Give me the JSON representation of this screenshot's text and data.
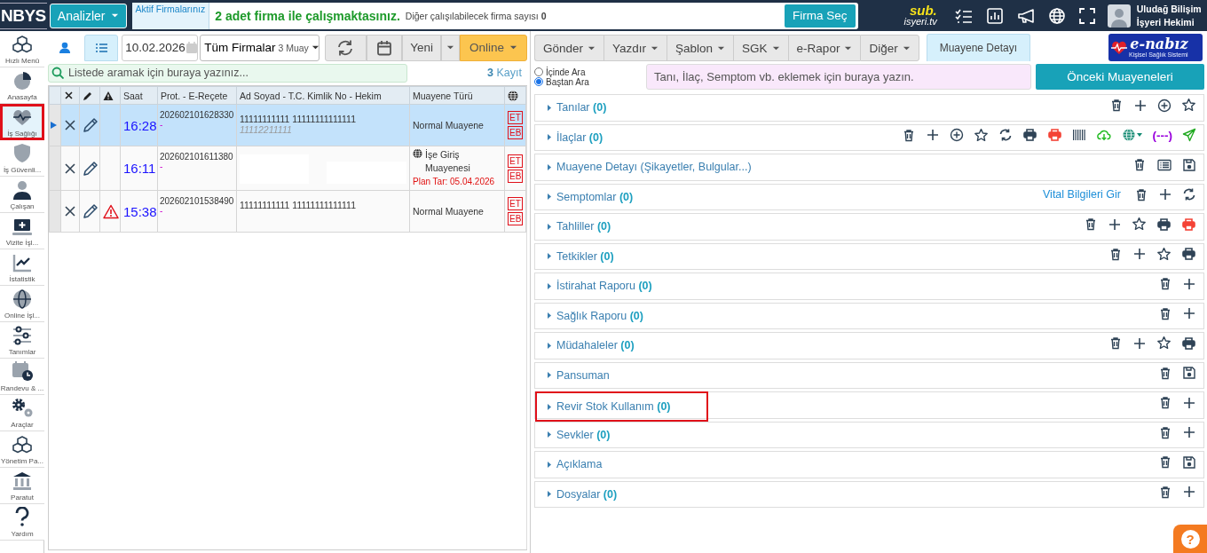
{
  "header": {
    "logo": "NBYS",
    "menu_button": "Analizler",
    "active_label": "Aktif Firmalarınız",
    "firms_message": "2 adet firma ile çalışmaktasınız.",
    "firms_note": "Diğer çalışılabilecek firma sayısı **0**",
    "select_button": "Firma Seç",
    "brand_top": "sub.",
    "brand_bottom": "isyeri.tv",
    "user_name": "Uludağ Bilişim",
    "user_role": "İşyeri Hekimi"
  },
  "sidebar": {
    "items": [
      {
        "label": "Hızlı Menü",
        "kind": "cubes",
        "selected": false,
        "highlighted": false
      },
      {
        "label": "Anasayfa",
        "kind": "pie",
        "selected": false,
        "highlighted": false
      },
      {
        "label": "İş Sağlığı",
        "kind": "heartbeat",
        "selected": true,
        "highlighted": true
      },
      {
        "label": "İş Güvenli...",
        "kind": "shield",
        "selected": false,
        "highlighted": false
      },
      {
        "label": "Çalışan",
        "kind": "user",
        "selected": false,
        "highlighted": false
      },
      {
        "label": "Vizite İşl...",
        "kind": "monitor",
        "selected": false,
        "highlighted": false
      },
      {
        "label": "İstatistik",
        "kind": "chart",
        "selected": false,
        "highlighted": false
      },
      {
        "label": "Online İşl...",
        "kind": "globe",
        "selected": false,
        "highlighted": false
      },
      {
        "label": "Tanımlar",
        "kind": "sliders",
        "selected": false,
        "highlighted": false
      },
      {
        "label": "Randevu & ...",
        "kind": "calendar",
        "selected": false,
        "highlighted": false
      },
      {
        "label": "Araçlar",
        "kind": "gears",
        "selected": false,
        "highlighted": false
      },
      {
        "label": "Yönetim Pa...",
        "kind": "cubes",
        "selected": false,
        "highlighted": false
      },
      {
        "label": "Paratut",
        "kind": "bank",
        "selected": false,
        "highlighted": false
      },
      {
        "label": "Yardım",
        "kind": "question",
        "selected": false,
        "highlighted": false
      }
    ]
  },
  "list_panel": {
    "view_tabs": [
      {
        "kind": "person",
        "selected": false
      },
      {
        "kind": "list",
        "selected": true
      }
    ],
    "date": "10.02.2026",
    "firm_filter": "Tüm Firmalar",
    "firm_filter_note": "3 Muay",
    "new_button": "Yeni",
    "online_button": "Online",
    "search": {
      "placeholder": "Listede aramak için buraya yazınız..."
    },
    "count": "3",
    "count_label": "Kayıt",
    "table": {
      "columns": [
        "Saat",
        "Prot. - E-Reçete",
        "Ad Soyad - T.C. Kimlik No - Hekim",
        "Muayene Türü"
      ],
      "rows": [
        {
          "selected": true,
          "warning": false,
          "time": "16:28",
          "protocol": "202602101628330",
          "protocol_note": "-",
          "name": "11111111111 11111111111111",
          "name_note": "11112211111",
          "redacted": false,
          "online": false,
          "type": "Normal Muayene",
          "plan": "",
          "badges": [
            "ET",
            "EB"
          ]
        },
        {
          "selected": false,
          "warning": false,
          "time": "16:11",
          "protocol": "202602101611380",
          "protocol_note": "-",
          "name": "",
          "name_note": "",
          "redacted": true,
          "online": true,
          "type": "İşe Giriş Muayenesi",
          "plan": "Plan Tar: 05.04.2026",
          "badges": [
            "ET",
            "EB"
          ]
        },
        {
          "selected": false,
          "warning": true,
          "time": "15:38",
          "protocol": "202602101538490",
          "protocol_note": "-",
          "name": "11111111111 11111111111111",
          "name_note": "",
          "redacted": false,
          "online": false,
          "type": "Normal Muayene",
          "plan": "",
          "badges": [
            "ET",
            "EB"
          ]
        }
      ]
    }
  },
  "detail_panel": {
    "toolbar": [
      "Gönder",
      "Yazdır",
      "Şablon",
      "SGK",
      "e-Rapor",
      "Diğer"
    ],
    "tabs": [
      {
        "label": "Muayene Detayı",
        "selected": true
      }
    ],
    "logo_title": "e-nabız",
    "logo_subtitle": "Kişisel Sağlık Sistemi",
    "search_modes": [
      {
        "label": "İçinde Ara",
        "selected": false
      },
      {
        "label": "Baştan Ara",
        "selected": true
      }
    ],
    "add_field": {
      "placeholder": "Tanı, İlaç, Semptom vb. eklemek için buraya yazın."
    },
    "previous_button": "Önceki Muayeneleri",
    "sections": [
      {
        "title": "Tanılar",
        "count": "(0)",
        "highlighted": false,
        "actions": [
          {
            "kind": "trash"
          },
          {
            "kind": "plus"
          },
          {
            "kind": "plus-circle"
          },
          {
            "kind": "star"
          }
        ]
      },
      {
        "title": "İlaçlar",
        "count": "(0)",
        "highlighted": false,
        "actions": [
          {
            "kind": "trash"
          },
          {
            "kind": "plus"
          },
          {
            "kind": "plus-circle"
          },
          {
            "kind": "star"
          },
          {
            "kind": "sync"
          },
          {
            "kind": "print"
          },
          {
            "kind": "print",
            "color": "#f44336"
          },
          {
            "kind": "barcode"
          },
          {
            "kind": "cloud",
            "color": "#22bb22"
          },
          {
            "kind": "globe",
            "color": "#138a72"
          },
          {
            "kind": "text",
            "text": "(---)",
            "color": "#9900dd"
          },
          {
            "kind": "send",
            "color": "#22aa22"
          }
        ]
      },
      {
        "title": "Muayene Detayı (Şikayetler, Bulgular...)",
        "highlighted": false,
        "actions": [
          {
            "kind": "trash"
          },
          {
            "kind": "list"
          },
          {
            "kind": "save"
          }
        ]
      },
      {
        "title": "Semptomlar",
        "count": "(0)",
        "link": "Vital Bilgileri Gir",
        "highlighted": false,
        "actions": [
          {
            "kind": "trash"
          },
          {
            "kind": "plus"
          },
          {
            "kind": "sync"
          }
        ]
      },
      {
        "title": "Tahliller",
        "count": "(0)",
        "highlighted": false,
        "actions": [
          {
            "kind": "trash"
          },
          {
            "kind": "plus"
          },
          {
            "kind": "star"
          },
          {
            "kind": "print"
          },
          {
            "kind": "print",
            "color": "#f44336"
          }
        ]
      },
      {
        "title": "Tetkikler",
        "count": "(0)",
        "highlighted": false,
        "actions": [
          {
            "kind": "trash"
          },
          {
            "kind": "plus"
          },
          {
            "kind": "star"
          },
          {
            "kind": "print"
          }
        ]
      },
      {
        "title": "İstirahat Raporu",
        "count": "(0)",
        "highlighted": false,
        "actions": [
          {
            "kind": "trash"
          },
          {
            "kind": "plus"
          }
        ]
      },
      {
        "title": "Sağlık Raporu",
        "count": "(0)",
        "highlighted": false,
        "actions": [
          {
            "kind": "trash"
          },
          {
            "kind": "plus"
          }
        ]
      },
      {
        "title": "Müdahaleler",
        "count": "(0)",
        "highlighted": false,
        "actions": [
          {
            "kind": "trash"
          },
          {
            "kind": "plus"
          },
          {
            "kind": "star"
          },
          {
            "kind": "print"
          }
        ]
      },
      {
        "title": "Pansuman",
        "highlighted": false,
        "actions": [
          {
            "kind": "trash"
          },
          {
            "kind": "save"
          }
        ]
      },
      {
        "title": "Revir Stok Kullanım",
        "count": "(0)",
        "highlighted": true,
        "actions": [
          {
            "kind": "trash"
          },
          {
            "kind": "plus"
          }
        ]
      },
      {
        "title": "Sevkler",
        "count": "(0)",
        "highlighted": false,
        "actions": [
          {
            "kind": "trash"
          },
          {
            "kind": "plus"
          }
        ]
      },
      {
        "title": "Açıklama",
        "highlighted": false,
        "actions": [
          {
            "kind": "trash"
          },
          {
            "kind": "save"
          }
        ]
      },
      {
        "title": "Dosyalar",
        "count": "(0)",
        "highlighted": false,
        "actions": [
          {
            "kind": "trash"
          },
          {
            "kind": "plus"
          }
        ]
      }
    ]
  },
  "help_button": "?"
}
